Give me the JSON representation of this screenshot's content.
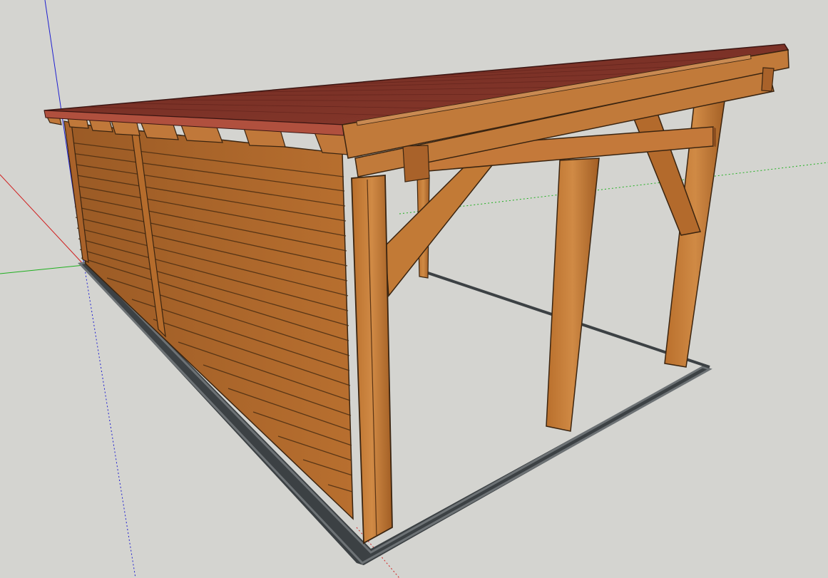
{
  "viewport": {
    "background": "#d4d4d0",
    "axes": {
      "red": "#d02020",
      "green": "#20b020",
      "blue": "#2020d0"
    }
  },
  "model": {
    "roof_color": "#7a2f26",
    "roof_edge_color": "#b0503e",
    "wood_light": "#c77e3a",
    "wood_mid": "#b0682b",
    "wood_dark": "#8a4d1f",
    "footprint_color": "#3c4144"
  }
}
